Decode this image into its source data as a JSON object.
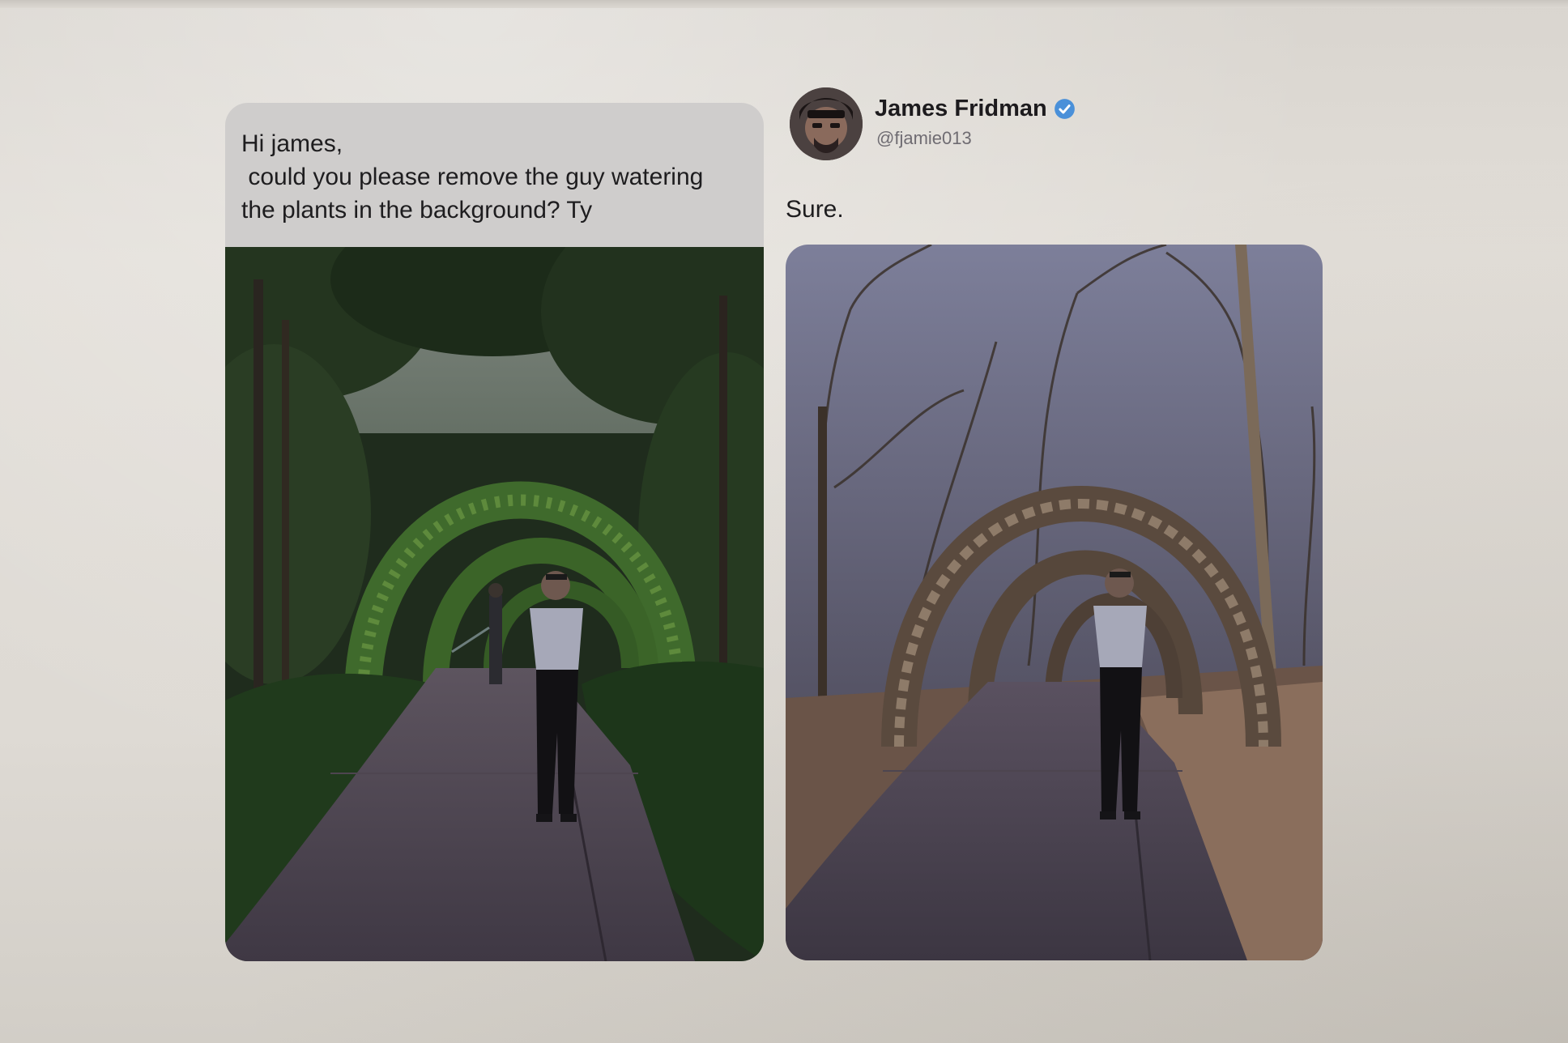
{
  "request": {
    "message": "Hi james,\n could you please remove the guy watering\nthe plants in the background? Ty",
    "photo": "original-garden-photo"
  },
  "reply": {
    "display_name": "James Fridman",
    "handle": "@fjamie013",
    "verified": true,
    "text": "Sure.",
    "photo": "edited-garden-photo"
  },
  "colors": {
    "verified_badge": "#4a90d9",
    "screen_background": "#dedad4",
    "request_bubble": "#cfcdcc"
  }
}
